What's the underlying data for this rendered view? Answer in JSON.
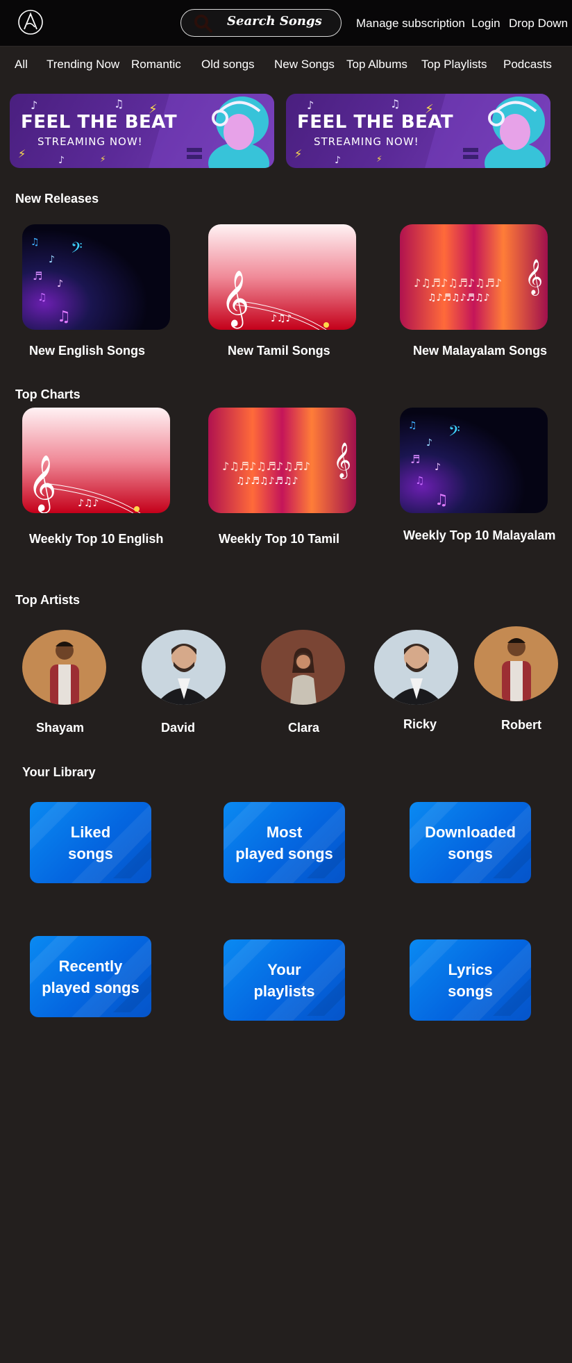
{
  "header": {
    "search_label": "Search Songs",
    "links": [
      "Manage subscription",
      "Login",
      "Drop Down"
    ]
  },
  "categories": [
    "All",
    "Trending Now",
    "Romantic",
    "Old songs",
    "New Songs",
    "Top Albums",
    "Top Playlists",
    "Podcasts"
  ],
  "banners": [
    {
      "title": "FEEL THE BEAT",
      "subtitle": "STREAMING NOW!"
    },
    {
      "title": "FEEL THE BEAT",
      "subtitle": "STREAMING NOW!"
    }
  ],
  "new_releases": {
    "title": "New Releases",
    "items": [
      "New English Songs",
      "New Tamil Songs",
      "New Malayalam Songs"
    ]
  },
  "top_charts": {
    "title": "Top Charts",
    "items": [
      "Weekly Top 10 English",
      "Weekly Top 10 Tamil",
      "Weekly Top 10 Malayalam"
    ]
  },
  "top_artists": {
    "title": "Top Artists",
    "items": [
      "Shayam",
      "David",
      "Clara",
      "Ricky",
      "Robert"
    ]
  },
  "library": {
    "title": "Your Library",
    "items": [
      "Liked\nsongs",
      "Most\nplayed songs",
      "Downloaded\nsongs",
      "Recently\nplayed songs",
      "Your\nplaylists",
      "Lyrics\nsongs"
    ]
  },
  "colors": {
    "background": "#231f1e",
    "topbar": "#080708",
    "library_card": "#0466e0",
    "banner": "#5b2a98"
  }
}
